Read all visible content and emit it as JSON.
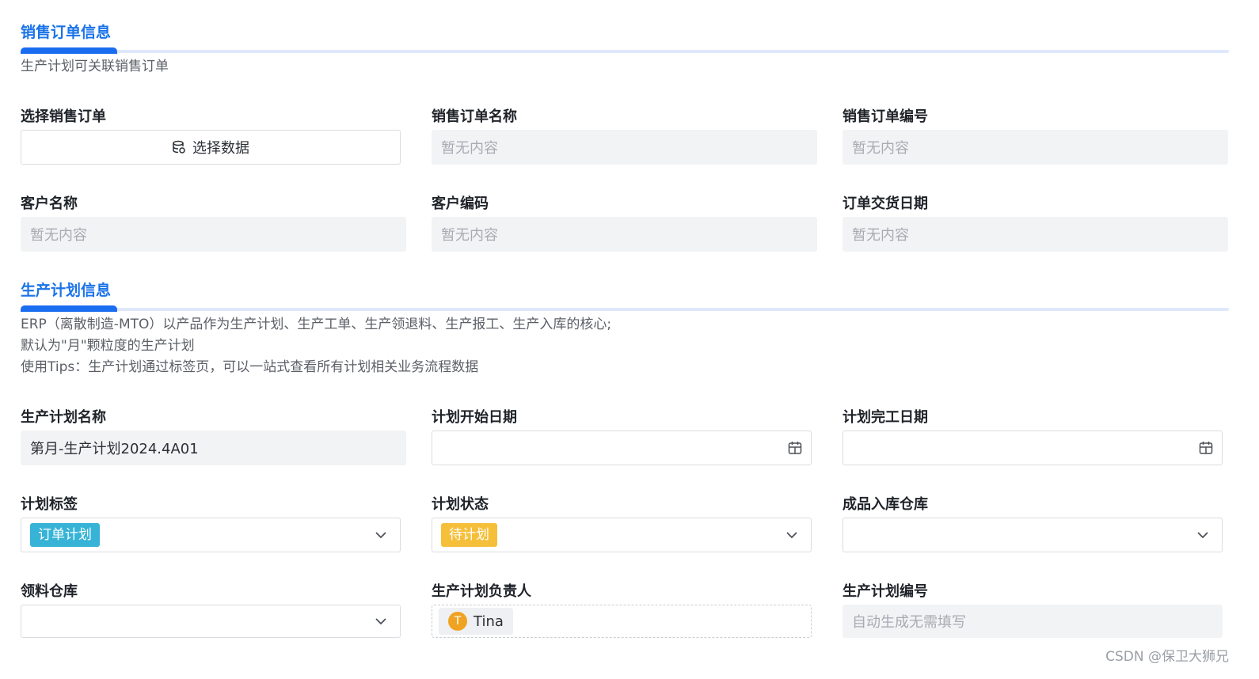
{
  "sales_section": {
    "title": "销售订单信息",
    "description": "生产计划可关联销售订单",
    "fields": {
      "select_order": {
        "label": "选择销售订单",
        "button_label": "选择数据",
        "icon": "database-icon"
      },
      "order_name": {
        "label": "销售订单名称",
        "placeholder": "暂无内容"
      },
      "order_number": {
        "label": "销售订单编号",
        "placeholder": "暂无内容"
      },
      "customer_name": {
        "label": "客户名称",
        "placeholder": "暂无内容"
      },
      "customer_code": {
        "label": "客户编码",
        "placeholder": "暂无内容"
      },
      "delivery_date": {
        "label": "订单交货日期",
        "placeholder": "暂无内容"
      }
    }
  },
  "plan_section": {
    "title": "生产计划信息",
    "description_lines": [
      "ERP（离散制造-MTO）以产品作为生产计划、生产工单、生产领退料、生产报工、生产入库的核心;",
      "默认为\"月\"颗粒度的生产计划",
      "使用Tips：生产计划通过标签页，可以一站式查看所有计划相关业务流程数据"
    ],
    "fields": {
      "plan_name": {
        "label": "生产计划名称",
        "value": "第月-生产计划2024.4A01"
      },
      "start_date": {
        "label": "计划开始日期",
        "value": "",
        "icon": "calendar-icon"
      },
      "end_date": {
        "label": "计划完工日期",
        "value": "",
        "icon": "calendar-icon"
      },
      "plan_tag": {
        "label": "计划标签",
        "selected": "订单计划",
        "tag_color": "#36b3d6"
      },
      "plan_status": {
        "label": "计划状态",
        "selected": "待计划",
        "tag_color": "#f5bf3a"
      },
      "finished_warehouse": {
        "label": "成品入库仓库",
        "selected": ""
      },
      "material_warehouse": {
        "label": "领料仓库",
        "selected": ""
      },
      "owner": {
        "label": "生产计划负责人",
        "person_name": "Tina",
        "avatar_initial": "T",
        "avatar_color": "#f0a322"
      },
      "plan_number": {
        "label": "生产计划编号",
        "placeholder": "自动生成无需填写"
      }
    }
  },
  "watermark": "CSDN @保卫大狮兄"
}
